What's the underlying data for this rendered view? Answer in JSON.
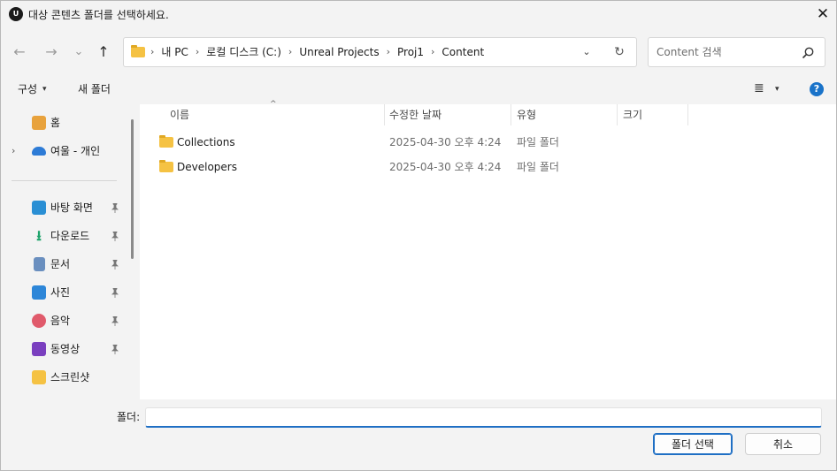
{
  "window": {
    "title": "대상 콘텐츠 폴더를 선택하세요.",
    "app_icon": "U",
    "close_glyph": "✕"
  },
  "nav": {
    "back_glyph": "←",
    "forward_glyph": "→",
    "recent_glyph": "⌄",
    "up_glyph": "↑"
  },
  "address": {
    "crumbs": [
      "내 PC",
      "로컬 디스크 (C:)",
      "Unreal Projects",
      "Proj1",
      "Content"
    ],
    "dropdown_glyph": "⌄",
    "refresh_glyph": "↻"
  },
  "search": {
    "placeholder": "Content 검색"
  },
  "command": {
    "organize_label": "구성",
    "new_folder_label": "새 폴더",
    "caret": "▾",
    "view_glyph": "≣",
    "help_glyph": "?"
  },
  "sidebar": {
    "items": [
      {
        "label": "홈",
        "icon": "home-icon",
        "pinned": false
      },
      {
        "label": "여울 - 개인",
        "icon": "onedrive-icon",
        "pinned": false,
        "expandable": true
      },
      {
        "label": "바탕 화면",
        "icon": "desktop-icon",
        "pinned": true
      },
      {
        "label": "다운로드",
        "icon": "download-icon",
        "pinned": true
      },
      {
        "label": "문서",
        "icon": "documents-icon",
        "pinned": true
      },
      {
        "label": "사진",
        "icon": "pictures-icon",
        "pinned": true
      },
      {
        "label": "음악",
        "icon": "music-icon",
        "pinned": true
      },
      {
        "label": "동영상",
        "icon": "videos-icon",
        "pinned": true
      },
      {
        "label": "스크린샷",
        "icon": "folder-icon",
        "pinned": false
      }
    ],
    "chevron": "›",
    "down_arrow": "⭳"
  },
  "columns": {
    "name": "이름",
    "modified": "수정한 날짜",
    "type": "유형",
    "size": "크기",
    "sort_caret": "^"
  },
  "rows": [
    {
      "name": "Collections",
      "modified": "2025-04-30 오후 4:24",
      "type": "파일 폴더"
    },
    {
      "name": "Developers",
      "modified": "2025-04-30 오후 4:24",
      "type": "파일 폴더"
    }
  ],
  "footer": {
    "folder_label": "폴더:",
    "folder_value": "",
    "select_button": "폴더 선택",
    "cancel_button": "취소"
  },
  "colors": {
    "accent": "#1f6fc4",
    "folder": "#f5c243",
    "help": "#1a73c9"
  }
}
